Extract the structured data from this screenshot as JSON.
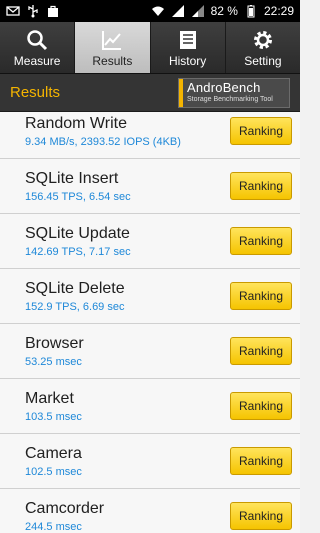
{
  "statusbar": {
    "battery_percent": "82 %",
    "time": "22:29"
  },
  "tabs": [
    {
      "label": "Measure",
      "icon": "search-icon"
    },
    {
      "label": "Results",
      "icon": "chart-icon"
    },
    {
      "label": "History",
      "icon": "list-icon"
    },
    {
      "label": "Setting",
      "icon": "gear-icon"
    }
  ],
  "results_header": {
    "title": "Results",
    "logo_name": "AndroBench",
    "logo_sub": "Storage Benchmarking Tool"
  },
  "items": [
    {
      "name": "Random Write",
      "value": "9.34 MB/s, 2393.52 IOPS (4KB)",
      "button": "Ranking"
    },
    {
      "name": "SQLite Insert",
      "value": "156.45 TPS, 6.54 sec",
      "button": "Ranking"
    },
    {
      "name": "SQLite Update",
      "value": "142.69 TPS, 7.17 sec",
      "button": "Ranking"
    },
    {
      "name": "SQLite Delete",
      "value": "152.9 TPS, 6.69 sec",
      "button": "Ranking"
    },
    {
      "name": "Browser",
      "value": "53.25 msec",
      "button": "Ranking"
    },
    {
      "name": "Market",
      "value": "103.5 msec",
      "button": "Ranking"
    },
    {
      "name": "Camera",
      "value": "102.5 msec",
      "button": "Ranking"
    },
    {
      "name": "Camcorder",
      "value": "244.5 msec",
      "button": "Ranking"
    }
  ],
  "colors": {
    "accent": "#f4b400",
    "value_text": "#1e88d8",
    "button": "#f5c400"
  }
}
